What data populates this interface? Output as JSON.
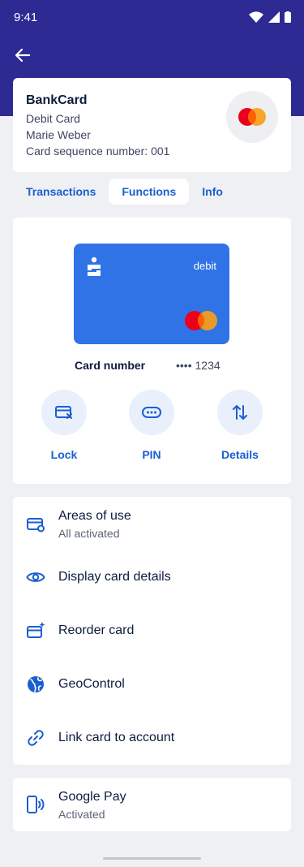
{
  "status_bar": {
    "time": "9:41"
  },
  "card_info": {
    "title": "BankCard",
    "type": "Debit Card",
    "holder": "Marie Weber",
    "sequence": "Card sequence number: 001"
  },
  "tabs": [
    {
      "label": "Transactions",
      "active": false
    },
    {
      "label": "Functions",
      "active": true
    },
    {
      "label": "Info",
      "active": false
    }
  ],
  "card_visual": {
    "bank_logo": "Ş",
    "card_type_label": "debit",
    "number_label": "Card number",
    "number_value": "•••• 1234"
  },
  "actions": [
    {
      "label": "Lock",
      "icon": "card-lock-icon"
    },
    {
      "label": "PIN",
      "icon": "pin-icon"
    },
    {
      "label": "Details",
      "icon": "swap-arrows-icon"
    }
  ],
  "menu": [
    {
      "title": "Areas of use",
      "subtitle": "All activated",
      "icon": "card-settings-icon"
    },
    {
      "title": "Display card details",
      "icon": "eye-icon"
    },
    {
      "title": "Reorder card",
      "icon": "card-sparkle-icon"
    },
    {
      "title": "GeoControl",
      "icon": "globe-icon"
    },
    {
      "title": "Link card to account",
      "icon": "link-icon"
    }
  ],
  "google_pay": {
    "title": "Google Pay",
    "subtitle": "Activated",
    "icon": "phone-nfc-icon"
  },
  "colors": {
    "header": "#2e2a94",
    "accent": "#1a5fd0",
    "card": "#2f73e6",
    "background": "#eff0f4"
  }
}
